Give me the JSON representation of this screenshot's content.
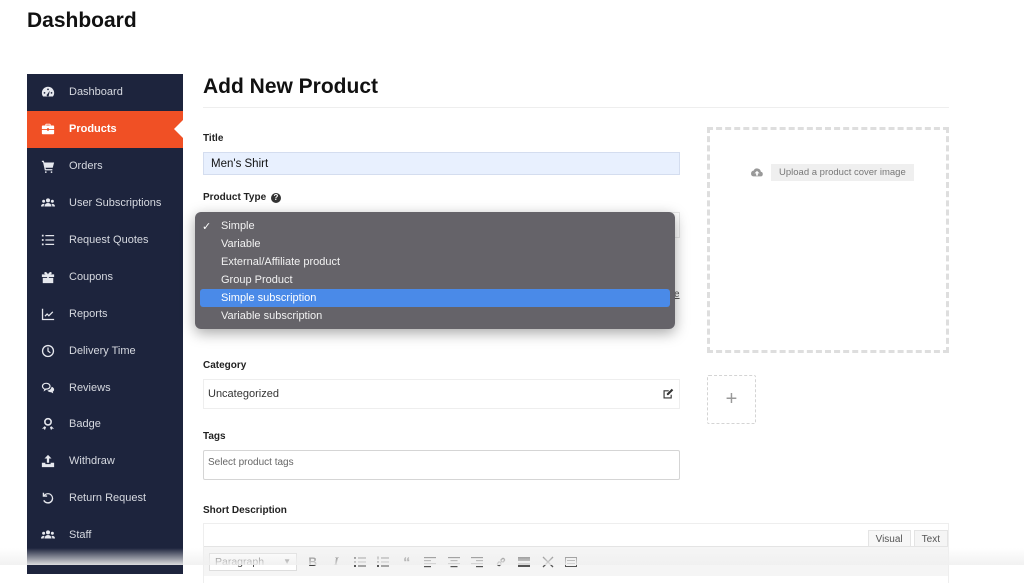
{
  "page": {
    "title": "Dashboard"
  },
  "sidebar": {
    "items": [
      {
        "label": "Dashboard",
        "icon": "dashboard-gauge-icon",
        "active": false
      },
      {
        "label": "Products",
        "icon": "briefcase-icon",
        "active": true
      },
      {
        "label": "Orders",
        "icon": "cart-icon",
        "active": false
      },
      {
        "label": "User Subscriptions",
        "icon": "users-icon",
        "active": false
      },
      {
        "label": "Request Quotes",
        "icon": "list-icon",
        "active": false
      },
      {
        "label": "Coupons",
        "icon": "gift-icon",
        "active": false
      },
      {
        "label": "Reports",
        "icon": "chart-line-icon",
        "active": false
      },
      {
        "label": "Delivery Time",
        "icon": "clock-icon",
        "active": false
      },
      {
        "label": "Reviews",
        "icon": "comments-icon",
        "active": false
      },
      {
        "label": "Badge",
        "icon": "award-icon",
        "active": false
      },
      {
        "label": "Withdraw",
        "icon": "upload-icon",
        "active": false
      },
      {
        "label": "Return Request",
        "icon": "undo-icon",
        "active": false
      },
      {
        "label": "Staff",
        "icon": "users-icon",
        "active": false
      }
    ]
  },
  "main": {
    "heading": "Add New Product",
    "title_label": "Title",
    "title_value": "Men's Shirt",
    "product_type_label": "Product Type",
    "product_type_help": "?",
    "product_type_dropdown": {
      "selected": "Simple",
      "highlighted": "Simple subscription",
      "options": [
        "Simple",
        "Variable",
        "External/Affiliate product",
        "Group Product",
        "Simple subscription",
        "Variable subscription"
      ]
    },
    "category_label": "Category",
    "category_value": "Uncategorized",
    "tags_label": "Tags",
    "tags_placeholder": "Select product tags",
    "short_description_label": "Short Description",
    "underlay_link_fragment": "e"
  },
  "media": {
    "cover_upload_label": "Upload a product cover image",
    "gallery_add_label": "+"
  },
  "editor": {
    "tabs": [
      "Visual",
      "Text"
    ],
    "format_value": "Paragraph",
    "toolbar": [
      "bold",
      "italic",
      "bulleted-list",
      "numbered-list",
      "blockquote",
      "align-left",
      "align-center",
      "align-right",
      "link",
      "read-more",
      "fullscreen",
      "toolbar-toggle"
    ]
  },
  "colors": {
    "sidebar_bg": "#1d243d",
    "active_accent": "#f05025",
    "dropdown_highlight": "#4a8ae8"
  }
}
